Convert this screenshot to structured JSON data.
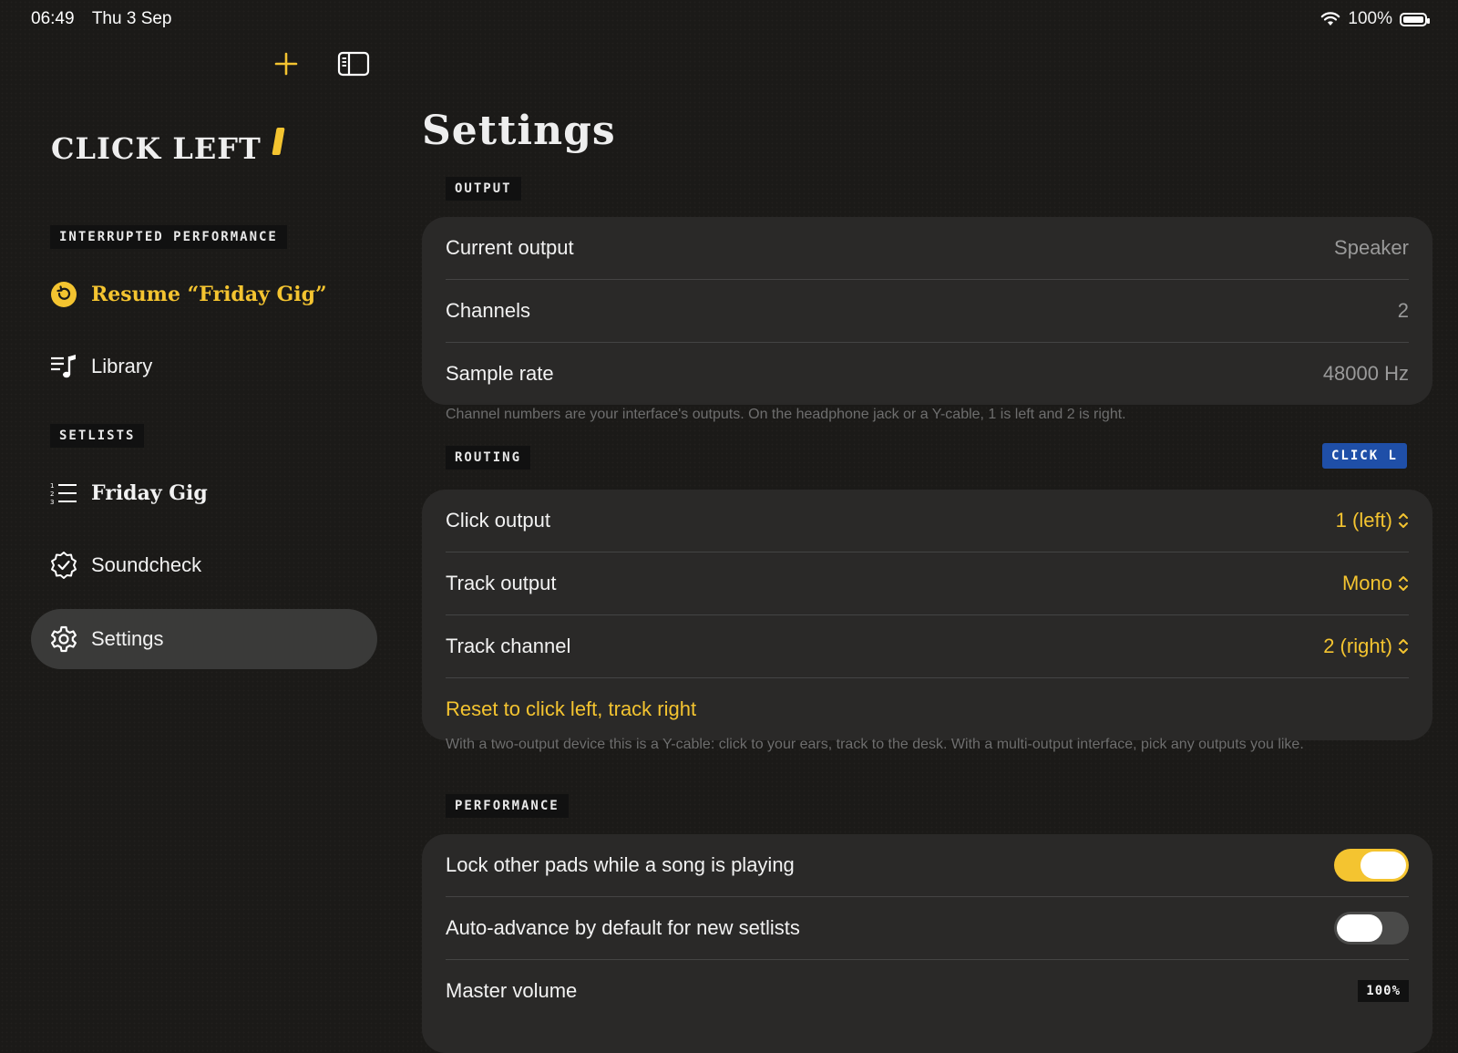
{
  "status": {
    "time": "06:49",
    "date": "Thu 3 Sep",
    "battery": "100%"
  },
  "sidebar": {
    "logo": "CLICK LEFT",
    "interrupted_label": "INTERRUPTED PERFORMANCE",
    "resume": "Resume “Friday Gig”",
    "library": "Library",
    "setlists_label": "SETLISTS",
    "setlist_item": "Friday Gig",
    "soundcheck": "Soundcheck",
    "settings": "Settings"
  },
  "main": {
    "title": "Settings",
    "output": {
      "label": "OUTPUT",
      "rows": [
        {
          "label": "Current output",
          "value": "Speaker"
        },
        {
          "label": "Channels",
          "value": "2"
        },
        {
          "label": "Sample rate",
          "value": "48000 Hz"
        }
      ],
      "footnote": "Channel numbers are your interface's outputs. On the headphone jack or a Y-cable, 1 is left and 2 is right."
    },
    "routing": {
      "label": "ROUTING",
      "badge": "CLICK L",
      "rows": [
        {
          "label": "Click output",
          "value": "1 (left)"
        },
        {
          "label": "Track output",
          "value": "Mono"
        },
        {
          "label": "Track channel",
          "value": "2 (right)"
        }
      ],
      "reset": "Reset to click left, track right",
      "footnote": "With a two-output device this is a Y-cable: click to your ears, track to the desk. With a multi-output interface, pick any outputs you like."
    },
    "performance": {
      "label": "PERFORMANCE",
      "rows": [
        {
          "label": "Lock other pads while a song is playing",
          "on": true
        },
        {
          "label": "Auto-advance by default for new setlists",
          "on": false
        },
        {
          "label": "Master volume",
          "value": "100%"
        }
      ]
    }
  },
  "colors": {
    "accent": "#f4c430",
    "badge": "#1f4fa8",
    "card": "#2a2928"
  }
}
